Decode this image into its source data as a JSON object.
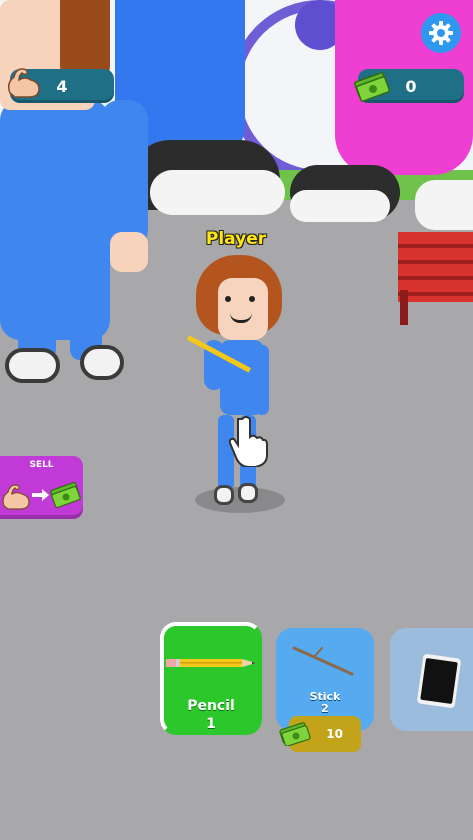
{
  "hud": {
    "strength_value": "4",
    "money_value": "0"
  },
  "player": {
    "name": "Player"
  },
  "sell_button": {
    "label": "SELL"
  },
  "items": [
    {
      "name": "Pencil",
      "level": "1",
      "selected": true
    },
    {
      "name": "Stick",
      "level": "2",
      "price": "10"
    },
    {
      "name": "",
      "level": ""
    }
  ],
  "icons": {
    "settings": "gear-icon",
    "strength": "flexed-bicep-icon",
    "money": "cash-stack-icon",
    "arrow": "arrow-right-icon",
    "tap": "pointing-hand-icon",
    "phone": "smartphone-icon"
  },
  "colors": {
    "hud_pill": "#1f6f86",
    "settings_button": "#2e98f0",
    "sell_button": "#c13ad8",
    "pencil_card": "#2bc72b",
    "stick_card": "#56aaf0",
    "locked_card": "#9bbcdd",
    "price_tag": "#c2a319",
    "player_name": "#ffe70f"
  }
}
